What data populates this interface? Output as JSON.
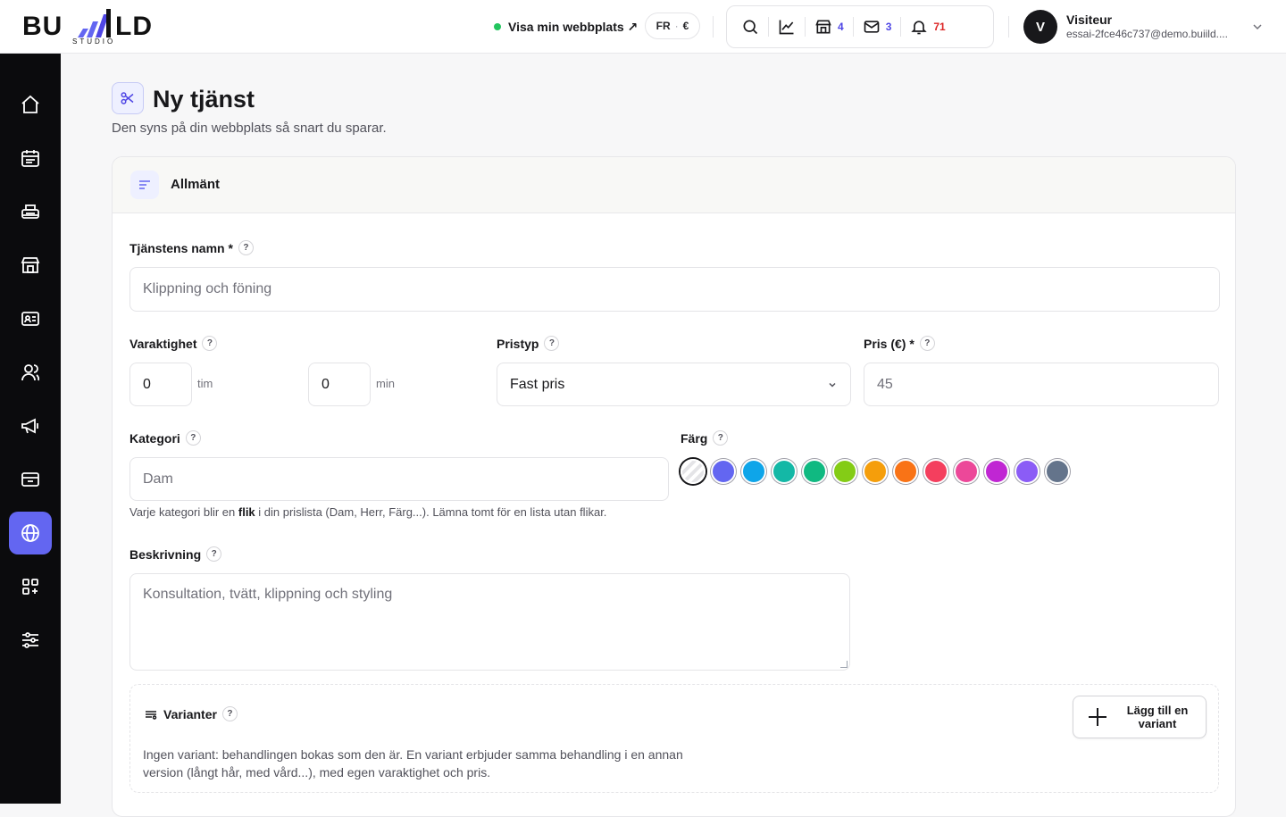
{
  "brand": {
    "logo_text_left": "BU",
    "logo_text_right": "LD",
    "logo_sub": "STUDIO"
  },
  "topbar": {
    "site_link_label": "Visa min webbplats ↗",
    "lang": "FR",
    "currency": "€",
    "shop_count": "4",
    "mail_count": "3",
    "notif_count": "71",
    "colors": {
      "accent": "#6366f1",
      "notif": "#dc2626",
      "online": "#22c55e"
    }
  },
  "user": {
    "initial": "V",
    "name": "Visiteur",
    "email": "essai-2fce46c737@demo.buiild...."
  },
  "sidebar": {
    "items": [
      {
        "icon": "home-icon"
      },
      {
        "icon": "calendar-icon"
      },
      {
        "icon": "printer-icon"
      },
      {
        "icon": "storefront-icon"
      },
      {
        "icon": "id-card-icon"
      },
      {
        "icon": "users-icon"
      },
      {
        "icon": "megaphone-icon"
      },
      {
        "icon": "card-icon"
      },
      {
        "icon": "globe-icon",
        "active": true
      },
      {
        "icon": "apps-add-icon"
      },
      {
        "icon": "sliders-icon"
      }
    ]
  },
  "page": {
    "title": "Ny tjänst",
    "subtitle": "Den syns på din webbplats så snart du sparar."
  },
  "general": {
    "section_title": "Allmänt",
    "name_label": "Tjänstens namn *",
    "name_placeholder": "Klippning och föning",
    "duration_label": "Varaktighet",
    "hours_value": "0",
    "hours_unit": "tim",
    "minutes_value": "0",
    "minutes_unit": "min",
    "price_type_label": "Pristyp",
    "price_type_value": "Fast pris",
    "price_label": "Pris (€) *",
    "price_placeholder": "45",
    "category_label": "Kategori",
    "category_placeholder": "Dam",
    "category_hint_before": "Varje kategori blir en ",
    "category_hint_bold": "flik",
    "category_hint_after": " i din prislista (Dam, Herr, Färg...). Lämna tomt för en lista utan flikar.",
    "color_label": "Färg",
    "colors": [
      "none",
      "#6366f1",
      "#0ea5e9",
      "#14b8a6",
      "#10b981",
      "#84cc16",
      "#f59e0b",
      "#f97316",
      "#f43f5e",
      "#ec4899",
      "#c026d3",
      "#8b5cf6",
      "#64748b"
    ],
    "description_label": "Beskrivning",
    "description_placeholder": "Konsultation, tvätt, klippning och styling"
  },
  "variants": {
    "title": "Varianter",
    "add_button": "Lägg till en variant",
    "empty_text": "Ingen variant: behandlingen bokas som den är. En variant erbjuder samma behandling i en annan version (långt hår, med vård...), med egen varaktighet och pris."
  }
}
